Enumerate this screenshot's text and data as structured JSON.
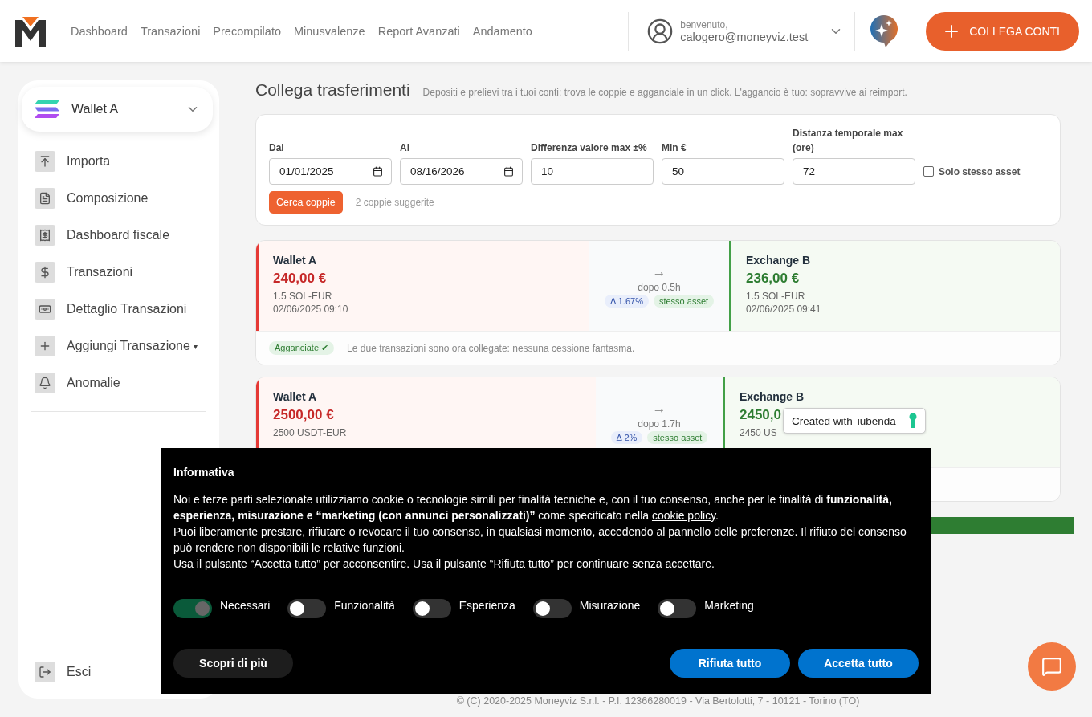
{
  "header": {
    "nav": [
      "Dashboard",
      "Transazioni",
      "Precompilato",
      "Minusvalenze",
      "Report Avanzati",
      "Andamento"
    ],
    "user": {
      "greeting": "benvenuto,",
      "email": "calogero@moneyviz.test"
    },
    "cta": "COLLEGA CONTI"
  },
  "sidebar": {
    "wallet": "Wallet A",
    "items": [
      {
        "label": "Importa",
        "dropdown": false
      },
      {
        "label": "Composizione",
        "dropdown": false
      },
      {
        "label": "Dashboard fiscale",
        "dropdown": false
      },
      {
        "label": "Transazioni",
        "dropdown": false
      },
      {
        "label": "Dettaglio Transazioni",
        "dropdown": false
      },
      {
        "label": "Aggiungi Transazione",
        "dropdown": true
      },
      {
        "label": "Anomalie",
        "dropdown": false
      }
    ],
    "caret": "▾",
    "logout": "Esci"
  },
  "page": {
    "title": "Collega trasferimenti",
    "subtitle": "Depositi e prelievi tra i tuoi conti: trova le coppie e agganciale in un click. L'aggancio è tuo: sopravvive ai reimport."
  },
  "filters": {
    "fields": [
      {
        "kind": "date",
        "label": "Dal",
        "value": "01/01/2025"
      },
      {
        "kind": "date",
        "label": "Al",
        "value": "08/16/2026"
      },
      {
        "kind": "text",
        "label": "Differenza valore max ±%",
        "value": "10"
      },
      {
        "kind": "text",
        "label": "Min €",
        "value": "50"
      },
      {
        "kind": "text",
        "label": "Distanza temporale max (ore)",
        "value": "72"
      }
    ],
    "same_asset": {
      "label": "Solo stesso asset",
      "checked": false
    },
    "search_button": "Cerca coppie",
    "result_count": "2 coppie suggerite"
  },
  "pairs": [
    {
      "from": {
        "account": "Wallet A",
        "amount": "240,00 €",
        "asset": "1.5 SOL-EUR",
        "date": "02/06/2025 09:10"
      },
      "arrow": "→",
      "gap": "dopo 0.5h",
      "delta": "Δ 1.67%",
      "same_asset": "stesso asset",
      "to": {
        "account": "Exchange B",
        "amount": "236,00 €",
        "asset": "1.5 SOL-EUR",
        "date": "02/06/2025 09:41"
      },
      "status": {
        "label": "Agganciate ✔",
        "message": "Le due transazioni sono ora collegate: nessuna cessione fantasma."
      }
    },
    {
      "from": {
        "account": "Wallet A",
        "amount": "2500,00 €",
        "asset": "2500 USDT-EUR"
      },
      "arrow": "→",
      "gap": "dopo 1.7h",
      "delta": "Δ 2%",
      "same_asset": "stesso asset",
      "to": {
        "account": "Exchange B",
        "amount": "2450,0",
        "asset": "2450 US"
      }
    }
  ],
  "footer": "© (C) 2020-2025 Moneyviz S.r.l. - P.I. 12366280019 - Via Bertolotti, 7 - 10121 - Torino (TO)",
  "iubenda_badge": {
    "text": "Created with",
    "link": "iubenda"
  },
  "cookie_banner": {
    "title": "Informativa",
    "intro": "Noi e terze parti selezionate utilizziamo cookie o tecnologie simili per finalità tecniche e, con il tuo consenso, anche per le finalità di **funzionalità, esperienza, misurazione e “marketing (con annunci personalizzati)”** come specificato nella",
    "link": "cookie policy",
    "intro_end": ".",
    "paragraphs": [
      "Puoi liberamente prestare, rifiutare o revocare il tuo consenso, in qualsiasi momento, accedendo al pannello delle preferenze. Il rifiuto del consenso può rendere non disponibili le relative funzioni.",
      "Usa il pulsante “Accetta tutto” per acconsentire. Usa il pulsante “Rifiuta tutto” per continuare senza accettare."
    ],
    "toggles": [
      {
        "label": "Necessari",
        "on": true
      },
      {
        "label": "Funzionalità",
        "on": false
      },
      {
        "label": "Esperienza",
        "on": false
      },
      {
        "label": "Misurazione",
        "on": false
      },
      {
        "label": "Marketing",
        "on": false
      }
    ],
    "learn_more": "Scopri di più",
    "reject": "Rifiuta tutto",
    "accept": "Accetta tutto"
  }
}
